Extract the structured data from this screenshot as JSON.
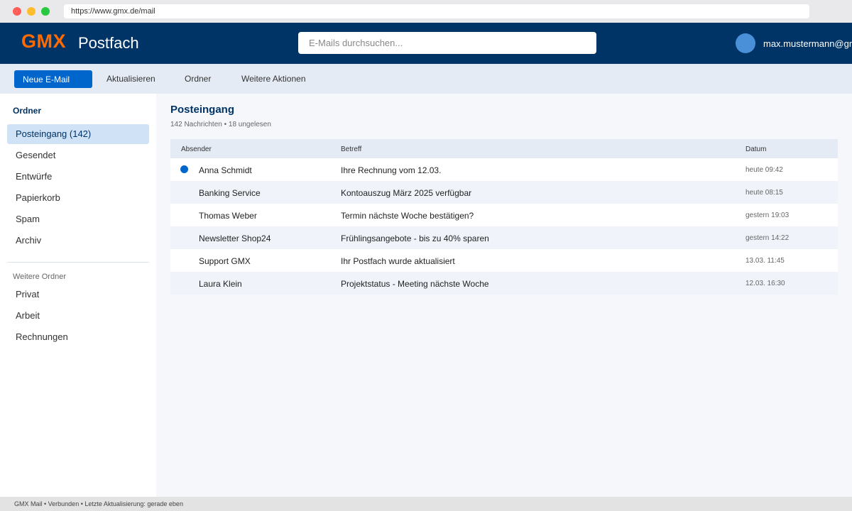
{
  "browser": {
    "url": "https://www.gmx.de/mail"
  },
  "header": {
    "logo": "GMX",
    "title": "Postfach",
    "search_placeholder": "E-Mails durchsuchen...",
    "username": "max.mustermann@gmx.de"
  },
  "toolbar": {
    "new_mail": "Neue E-Mail",
    "refresh": "Aktualisieren",
    "folder": "Ordner",
    "more_actions": "Weitere Aktionen"
  },
  "sidebar": {
    "heading": "Ordner",
    "items": [
      {
        "label": "Posteingang (142)",
        "active": true
      },
      {
        "label": "Gesendet"
      },
      {
        "label": "Entwürfe"
      },
      {
        "label": "Papierkorb"
      },
      {
        "label": "Spam"
      },
      {
        "label": "Archiv"
      }
    ],
    "more_heading": "Weitere Ordner",
    "more_items": [
      {
        "label": "Privat"
      },
      {
        "label": "Arbeit"
      },
      {
        "label": "Rechnungen"
      }
    ]
  },
  "main": {
    "title": "Posteingang",
    "subtitle": "142 Nachrichten • 18 ungelesen",
    "columns": {
      "sender": "Absender",
      "subject": "Betreff",
      "date": "Datum"
    },
    "emails": [
      {
        "sender": "Anna Schmidt",
        "subject": "Ihre Rechnung vom 12.03.",
        "date": "heute 09:42",
        "unread": true
      },
      {
        "sender": "Banking Service",
        "subject": "Kontoauszug März 2025 verfügbar",
        "date": "heute 08:15",
        "unread": false
      },
      {
        "sender": "Thomas Weber",
        "subject": "Termin nächste Woche bestätigen?",
        "date": "gestern 19:03",
        "unread": false
      },
      {
        "sender": "Newsletter Shop24",
        "subject": "Frühlingsangebote - bis zu 40% sparen",
        "date": "gestern 14:22",
        "unread": false
      },
      {
        "sender": "Support GMX",
        "subject": "Ihr Postfach wurde aktualisiert",
        "date": "13.03. 11:45",
        "unread": false
      },
      {
        "sender": "Laura Klein",
        "subject": "Projektstatus - Meeting nächste Woche",
        "date": "12.03. 16:30",
        "unread": false
      }
    ]
  },
  "status_bar": {
    "text": "GMX Mail • Verbunden • Letzte Aktualisierung: gerade eben"
  },
  "colors": {
    "header_bg": "#003366",
    "logo": "#ff6b00",
    "accent": "#0066cc"
  }
}
